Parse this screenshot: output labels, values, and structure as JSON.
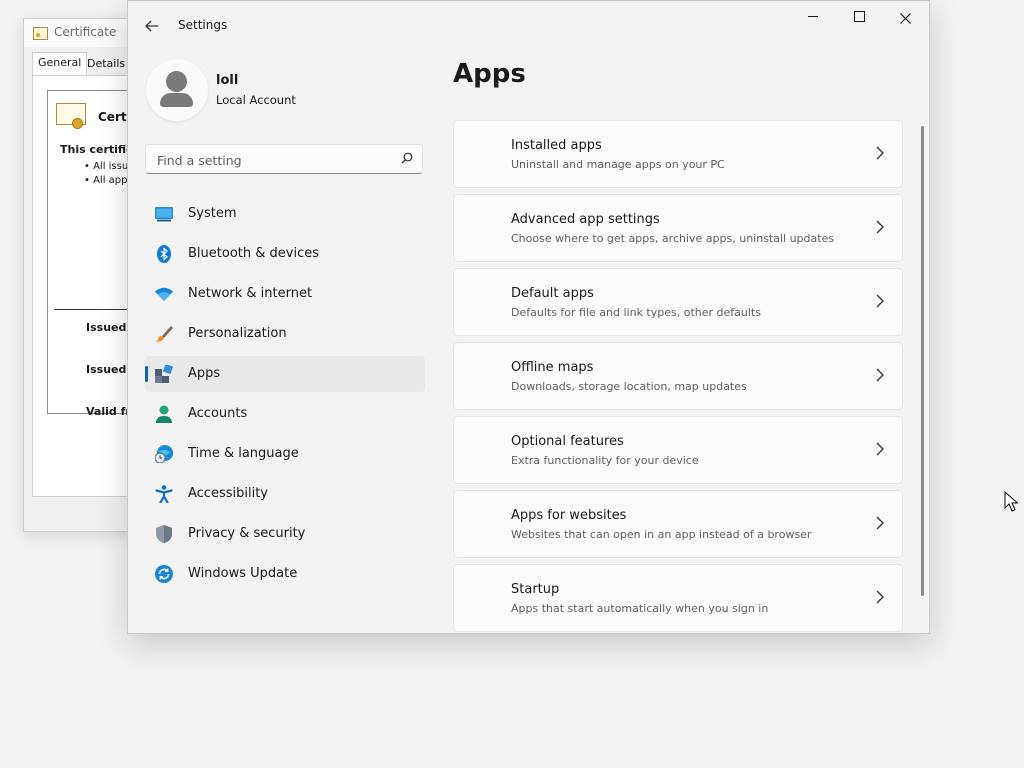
{
  "background_dialog": {
    "title": "Certificate",
    "tabs": [
      "General",
      "Details"
    ],
    "heading": "Certif",
    "line1": "This certifica",
    "bullets": [
      "• All issua",
      "• All appli"
    ],
    "fields": [
      "Issued t",
      "Issued l",
      "Valid fr"
    ]
  },
  "window": {
    "title": "Settings",
    "back_icon": "arrow-left-icon",
    "controls": [
      "minimize-icon",
      "maximize-icon",
      "close-icon"
    ]
  },
  "profile": {
    "name": "loll",
    "account_type": "Local Account"
  },
  "search": {
    "placeholder": "Find a setting"
  },
  "nav": {
    "items": [
      {
        "label": "System",
        "icon": "monitor-icon",
        "selected": false
      },
      {
        "label": "Bluetooth & devices",
        "icon": "bluetooth-icon",
        "selected": false
      },
      {
        "label": "Network & internet",
        "icon": "wifi-icon",
        "selected": false
      },
      {
        "label": "Personalization",
        "icon": "brush-icon",
        "selected": false
      },
      {
        "label": "Apps",
        "icon": "apps-icon",
        "selected": true
      },
      {
        "label": "Accounts",
        "icon": "person-icon",
        "selected": false
      },
      {
        "label": "Time & language",
        "icon": "globe-clock-icon",
        "selected": false
      },
      {
        "label": "Accessibility",
        "icon": "accessibility-icon",
        "selected": false
      },
      {
        "label": "Privacy & security",
        "icon": "shield-icon",
        "selected": false
      },
      {
        "label": "Windows Update",
        "icon": "update-icon",
        "selected": false
      }
    ]
  },
  "main": {
    "title": "Apps",
    "cards": [
      {
        "title": "Installed apps",
        "description": "Uninstall and manage apps on your PC"
      },
      {
        "title": "Advanced app settings",
        "description": "Choose where to get apps, archive apps, uninstall updates"
      },
      {
        "title": "Default apps",
        "description": "Defaults for file and link types, other defaults"
      },
      {
        "title": "Offline maps",
        "description": "Downloads, storage location, map updates"
      },
      {
        "title": "Optional features",
        "description": "Extra functionality for your device"
      },
      {
        "title": "Apps for websites",
        "description": "Websites that can open in an app instead of a browser"
      },
      {
        "title": "Startup",
        "description": "Apps that start automatically when you sign in"
      }
    ]
  },
  "colors": {
    "accent": "#0067c0",
    "window_bg": "#f3f3f3",
    "card_bg": "#fbfbfb",
    "selected_bg": "#e9e9e9"
  }
}
